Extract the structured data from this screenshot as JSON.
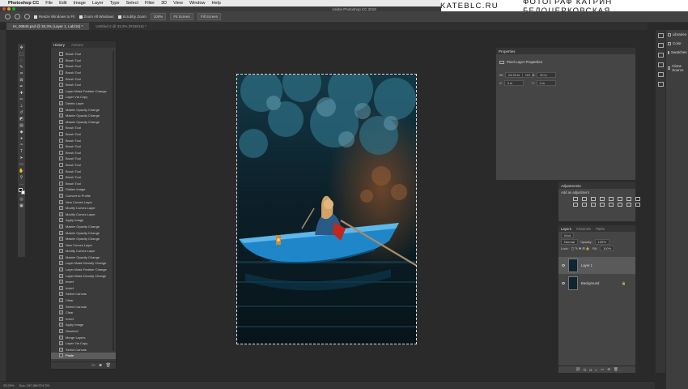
{
  "menubar": {
    "apple_glyph": "",
    "app_name": "Photoshop CC",
    "items": [
      "File",
      "Edit",
      "Image",
      "Layer",
      "Type",
      "Select",
      "Filter",
      "3D",
      "View",
      "Window",
      "Help"
    ]
  },
  "watermark": {
    "site": "KATEBLC.RU",
    "author": "ФОТОГРАФ КАТРИН БЕЛОЦЕРКОВСКАЯ"
  },
  "window": {
    "title": "Adobe Photoshop CC 2019"
  },
  "options_bar": {
    "resize_windows": "Resize Windows to Fit",
    "zoom_all": "Zoom All Windows",
    "scrubby_zoom": "Scrubby Zoom",
    "zoom_pct": "100%",
    "fit_screen": "Fit Screen",
    "fill_screen": "Fill Screen"
  },
  "tabs": [
    {
      "label": "IH_00840.psd @ 33,3% (Layer 1, Lab/16) *"
    },
    {
      "label": "Untitled-2 @ 33,3% (RGB/16) *"
    }
  ],
  "history": {
    "tab_history": "History",
    "tab_actions": "Actions",
    "items": [
      "Brush Tool",
      "Brush Tool",
      "Brush Tool",
      "Brush Tool",
      "Brush Tool",
      "Brush Tool",
      "Layer Mask Feather Change",
      "Layer Via Copy",
      "Delete Layer",
      "Master Opacity Change",
      "Master Opacity Change",
      "Master Opacity Change",
      "Brush Tool",
      "Brush Tool",
      "Brush Tool",
      "Brush Tool",
      "Brush Tool",
      "Brush Tool",
      "Brush Tool",
      "Brush Tool",
      "Brush Tool",
      "Brush Tool",
      "Flatten Image",
      "Convert to Profile",
      "New Curves Layer",
      "Modify Curves Layer",
      "Modify Curves Layer",
      "Apply Image",
      "Master Opacity Change",
      "Master Opacity Change",
      "Master Opacity Change",
      "New Curves Layer",
      "Modify Curves Layer",
      "Master Opacity Change",
      "Layer Mask Density Change",
      "Layer Mask Feather Change",
      "Layer Mask Density Change",
      "Invert",
      "Invert",
      "Select Canvas",
      "Clear",
      "Select Canvas",
      "Clear",
      "Invert",
      "Apply Image",
      "Deselect",
      "Merge Layers",
      "Layer Via Copy",
      "Select Canvas",
      "Paste"
    ]
  },
  "properties": {
    "title": "Properties",
    "subtitle": "Pixel Layer Properties",
    "w_label": "W:",
    "w_value": "13,33 in",
    "go_label": "GO",
    "h_label": "H:",
    "h_value": "20 in",
    "x_label": "X:",
    "x_value": "0 in",
    "y_label": "Y:",
    "y_value": "0 in"
  },
  "adjustments": {
    "title": "Adjustments",
    "label": "Add an adjustment"
  },
  "layers": {
    "tabs": [
      "Layers",
      "Channels",
      "Paths"
    ],
    "kind": "Kind",
    "blend": "Normal",
    "opacity_label": "Opacity:",
    "opacity": "100%",
    "lock_label": "Lock:",
    "fill_label": "Fill:",
    "fill": "100%",
    "items": [
      {
        "name": "Layer 1"
      },
      {
        "name": "Background"
      }
    ]
  },
  "dock": {
    "libraries": "Libraries",
    "color": "Color",
    "swatches": "Swatches",
    "clone_source": "Clone Source"
  },
  "status": {
    "zoom": "33,33%",
    "doc": "Doc: 187,8M/374,7M"
  },
  "colors": {
    "accent_boat": "#1f87c9",
    "water": "#0b1b22"
  }
}
